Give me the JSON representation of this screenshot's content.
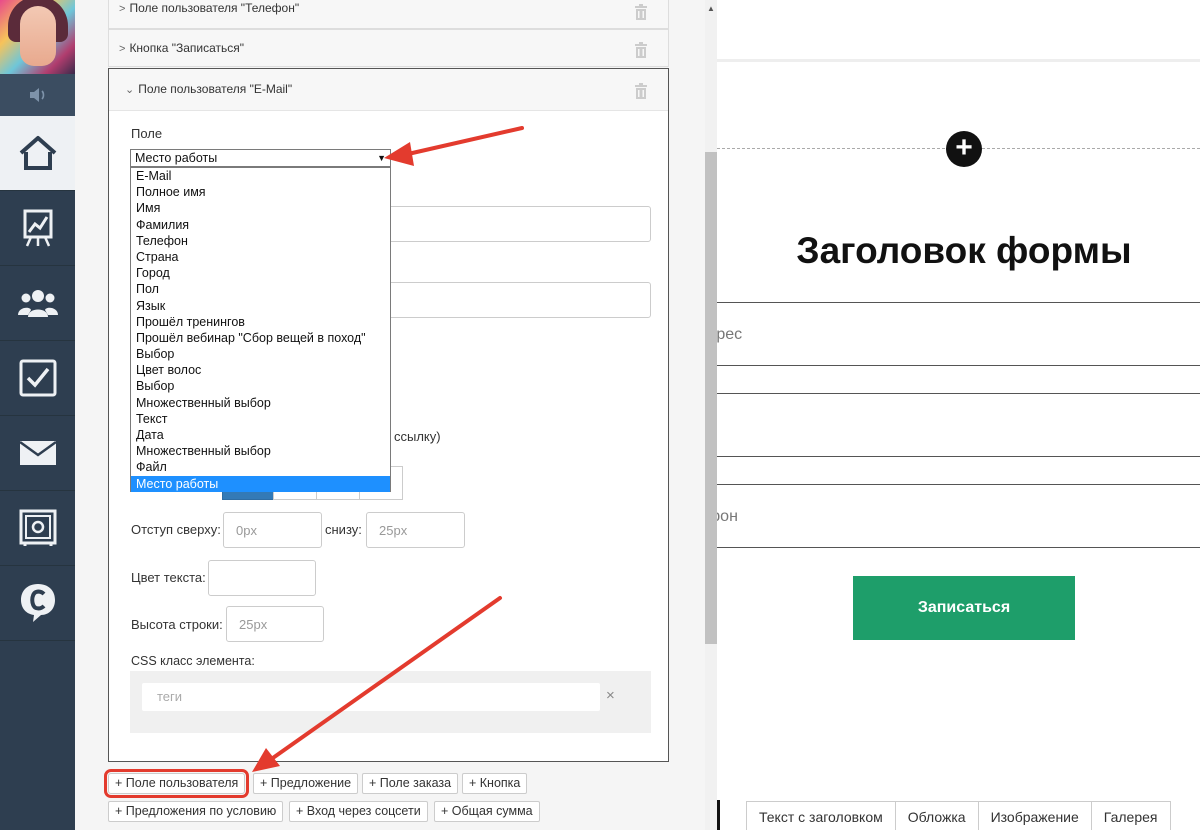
{
  "sidebar": {
    "items": [
      {
        "icon": "home-icon",
        "active": true
      },
      {
        "icon": "chart-board-icon"
      },
      {
        "icon": "users-group-icon"
      },
      {
        "icon": "checkbox-icon"
      },
      {
        "icon": "mail-icon"
      },
      {
        "icon": "safe-icon"
      },
      {
        "icon": "chat-c-icon"
      }
    ]
  },
  "editor": {
    "collapsed": [
      {
        "title": "Поле пользователя \"Телефон\""
      },
      {
        "title": "Кнопка \"Записаться\""
      }
    ],
    "expanded_title": "Поле пользователя \"E-Mail\"",
    "field_label": "Поле",
    "select_value": "Место работы",
    "dropdown_options": [
      "E-Mail",
      "Полное имя",
      "Имя",
      "Фамилия",
      "Телефон",
      "Страна",
      "Город",
      "Пол",
      "Язык",
      "Прошёл тренингов",
      "Прошёл вебинар \"Сбор вещей в поход\"",
      "Выбор",
      "Цвет волос",
      "Выбор",
      "Множественный выбор",
      "Текст",
      "Дата",
      "Множественный выбор",
      "Файл",
      "Место работы"
    ],
    "dropdown_selected_index": 19,
    "link_fragment": "ссылку)",
    "margin_top_label": "Отступ сверху:",
    "margin_top_placeholder": "0px",
    "margin_bottom_label": "снизу:",
    "margin_bottom_placeholder": "25px",
    "text_color_label": "Цвет текста:",
    "line_height_label": "Высота строки:",
    "line_height_placeholder": "25px",
    "css_class_label": "CSS класс элемента:",
    "tags_placeholder": "теги",
    "tags_clear": "×"
  },
  "add_buttons": {
    "row1": [
      "+ Поле пользователя",
      "+ Предложение",
      "+ Поле заказа",
      "+ Кнопка"
    ],
    "row2": [
      "+ Предложения по условию",
      "+ Вход через соцсети",
      "+ Общая сумма"
    ]
  },
  "preview": {
    "plus": "+",
    "form_title": "Заголовок формы",
    "field_fragments": [
      "дрес",
      "",
      "фон"
    ],
    "submit_label": "Записаться",
    "tabs": [
      "Текст с заголовком",
      "Обложка",
      "Изображение",
      "Галерея"
    ]
  },
  "colors": {
    "sidebar_bg": "#2e3e50",
    "accent_green": "#1e9e6a",
    "arrow_red": "#e33b2e",
    "select_highlight": "#1e90ff"
  }
}
